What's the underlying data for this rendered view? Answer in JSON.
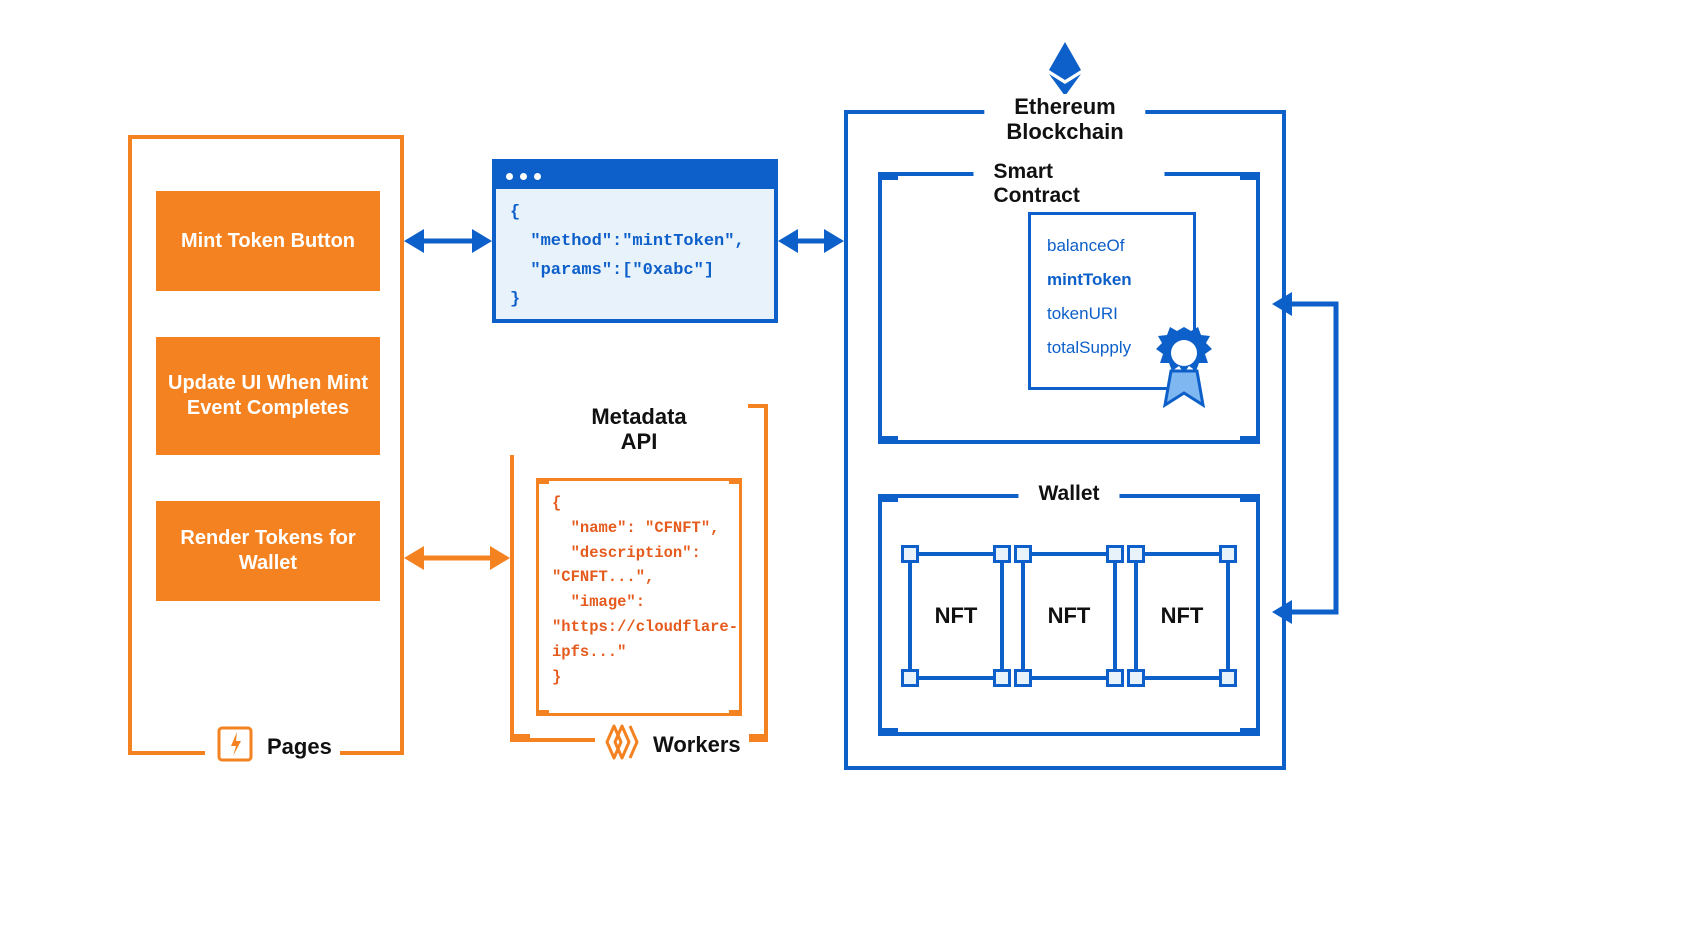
{
  "colors": {
    "orange": "#f58220",
    "blue": "#0d5fca",
    "lightblue": "#e8f2fb",
    "codeorange": "#e55b1d"
  },
  "pages": {
    "label": "Pages",
    "buttons": [
      "Mint Token Button",
      "Update UI When Mint Event Completes",
      "Render Tokens for Wallet"
    ]
  },
  "json_payload": {
    "lines": [
      "{",
      "  \"method\":\"mintToken\",",
      "  \"params\":[\"0xabc\"]",
      "}"
    ]
  },
  "metadata_api": {
    "title": "Metadata\nAPI",
    "code": "{\n  \"name\": \"CFNFT\",\n  \"description\": \"CFNFT...\",\n  \"image\": \"https://cloudflare-ipfs...\"\n}"
  },
  "workers": {
    "label": "Workers"
  },
  "ethereum": {
    "title": "Ethereum\nBlockchain",
    "smart_contract": {
      "title": "Smart Contract",
      "methods": [
        "balanceOf",
        "mintToken",
        "tokenURI",
        "totalSupply"
      ],
      "highlighted": "mintToken"
    },
    "wallet": {
      "title": "Wallet",
      "nfts": [
        "NFT",
        "NFT",
        "NFT"
      ]
    }
  }
}
